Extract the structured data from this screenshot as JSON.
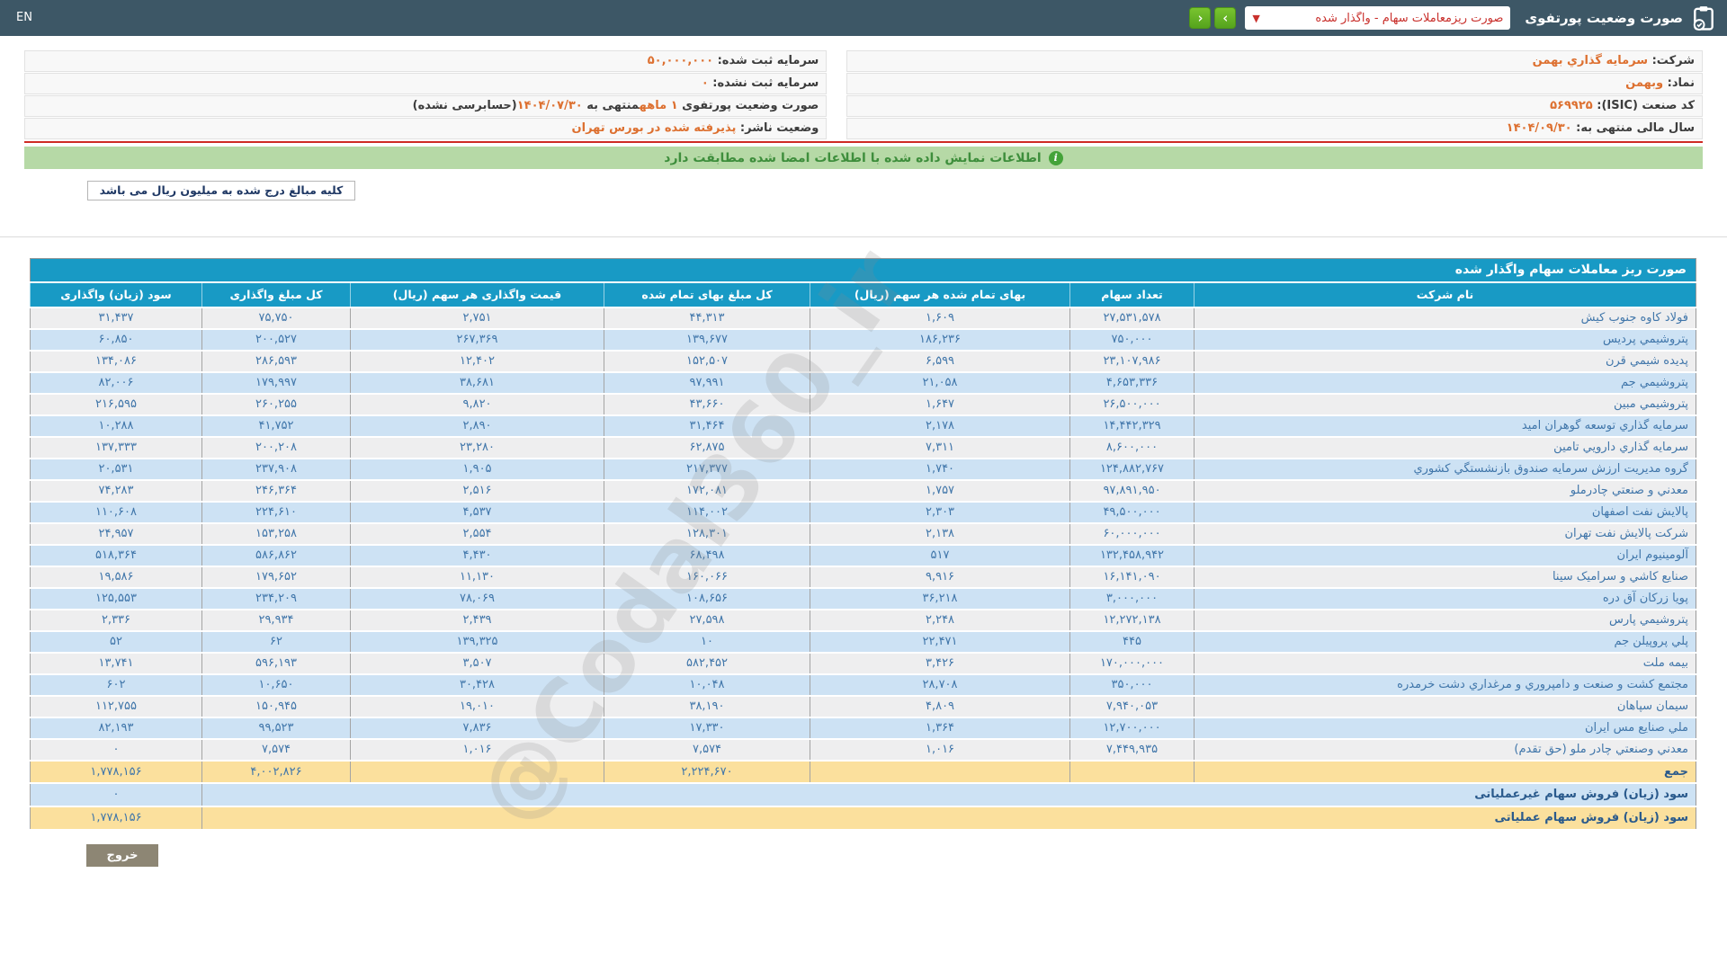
{
  "topbar": {
    "en_label": "EN",
    "page_title": "صورت وضعیت پورتفوی",
    "dropdown_value": "صورت ریزمعاملات سهام - واگذار شده",
    "dropdown_chevron": "▼",
    "next_icon": "›",
    "prev_icon": "‹"
  },
  "company_info": {
    "rows": [
      {
        "right": [
          {
            "t": "شرکت: ",
            "c": "label"
          },
          {
            "t": "سرمایه گذاري بهمن",
            "c": "value"
          }
        ],
        "left": [
          {
            "t": "سرمایه ثبت شده: ",
            "c": "label"
          },
          {
            "t": "۵۰,۰۰۰,۰۰۰",
            "c": "value"
          }
        ]
      },
      {
        "right": [
          {
            "t": "نماد: ",
            "c": "label"
          },
          {
            "t": "وبهمن",
            "c": "value"
          }
        ],
        "left": [
          {
            "t": "سرمایه ثبت نشده: ",
            "c": "label"
          },
          {
            "t": "۰",
            "c": "value"
          }
        ]
      },
      {
        "right": [
          {
            "t": "کد صنعت (ISIC): ",
            "c": "label"
          },
          {
            "t": "۵۶۹۹۲۵",
            "c": "value"
          }
        ],
        "left": [
          {
            "t": "صورت وضعیت پورتفوی ",
            "c": "label"
          },
          {
            "t": "۱ ماهه",
            "c": "value"
          },
          {
            "t": "منتهی به ",
            "c": "label"
          },
          {
            "t": "۱۴۰۴/۰۷/۳۰",
            "c": "value"
          },
          {
            "t": "(حسابرسی نشده)",
            "c": "label"
          }
        ]
      },
      {
        "right": [
          {
            "t": "سال مالی منتهی به: ",
            "c": "label"
          },
          {
            "t": "۱۴۰۴/۰۹/۳۰",
            "c": "value"
          }
        ],
        "left": [
          {
            "t": "وضعیت ناشر: ",
            "c": "label"
          },
          {
            "t": "پذیرفته شده در بورس تهران",
            "c": "value"
          }
        ]
      }
    ]
  },
  "signature_bar": {
    "text": "اطلاعات نمایش داده شده با اطلاعات امضا شده مطابقت دارد",
    "icon": "i"
  },
  "unit_note": {
    "text": "کلیه مبالغ درج شده به میلیون ریال می باشد"
  },
  "table": {
    "title": "صورت ریز معاملات سهام واگذار شده",
    "columns": [
      "نام شرکت",
      "تعداد سهام",
      "بهای تمام شده هر سهم (ریال)",
      "کل مبلغ بهای تمام شده",
      "قیمت واگذاری هر سهم (ریال)",
      "کل مبلغ واگذاری",
      "سود (زیان) واگذاری"
    ],
    "rows": [
      [
        "فولاد کاوه جنوب کیش",
        "۲۷,۵۳۱,۵۷۸",
        "۱,۶۰۹",
        "۴۴,۳۱۳",
        "۲,۷۵۱",
        "۷۵,۷۵۰",
        "۳۱,۴۳۷"
      ],
      [
        "پتروشیمي پردیس",
        "۷۵۰,۰۰۰",
        "۱۸۶,۲۳۶",
        "۱۳۹,۶۷۷",
        "۲۶۷,۳۶۹",
        "۲۰۰,۵۲۷",
        "۶۰,۸۵۰"
      ],
      [
        "پدیده شیمي قرن",
        "۲۳,۱۰۷,۹۸۶",
        "۶,۵۹۹",
        "۱۵۲,۵۰۷",
        "۱۲,۴۰۲",
        "۲۸۶,۵۹۳",
        "۱۳۴,۰۸۶"
      ],
      [
        "پتروشیمي جم",
        "۴,۶۵۳,۳۳۶",
        "۲۱,۰۵۸",
        "۹۷,۹۹۱",
        "۳۸,۶۸۱",
        "۱۷۹,۹۹۷",
        "۸۲,۰۰۶"
      ],
      [
        "پتروشیمي مبین",
        "۲۶,۵۰۰,۰۰۰",
        "۱,۶۴۷",
        "۴۳,۶۶۰",
        "۹,۸۲۰",
        "۲۶۰,۲۵۵",
        "۲۱۶,۵۹۵"
      ],
      [
        "سرمایه گذاري توسعه گوهران امید",
        "۱۴,۴۴۲,۳۲۹",
        "۲,۱۷۸",
        "۳۱,۴۶۴",
        "۲,۸۹۰",
        "۴۱,۷۵۲",
        "۱۰,۲۸۸"
      ],
      [
        "سرمایه گذاري دارویي تامین",
        "۸,۶۰۰,۰۰۰",
        "۷,۳۱۱",
        "۶۲,۸۷۵",
        "۲۳,۲۸۰",
        "۲۰۰,۲۰۸",
        "۱۳۷,۳۳۳"
      ],
      [
        "گروه مدیریت ارزش سرمایه صندوق بازنشستگي کشوري",
        "۱۲۴,۸۸۲,۷۶۷",
        "۱,۷۴۰",
        "۲۱۷,۳۷۷",
        "۱,۹۰۵",
        "۲۳۷,۹۰۸",
        "۲۰,۵۳۱"
      ],
      [
        "معدني و صنعتي چادرملو",
        "۹۷,۸۹۱,۹۵۰",
        "۱,۷۵۷",
        "۱۷۲,۰۸۱",
        "۲,۵۱۶",
        "۲۴۶,۳۶۴",
        "۷۴,۲۸۳"
      ],
      [
        "پالایش نفت اصفهان",
        "۴۹,۵۰۰,۰۰۰",
        "۲,۳۰۳",
        "۱۱۴,۰۰۲",
        "۴,۵۳۷",
        "۲۲۴,۶۱۰",
        "۱۱۰,۶۰۸"
      ],
      [
        "شرکت پالایش نفت تهران",
        "۶۰,۰۰۰,۰۰۰",
        "۲,۱۳۸",
        "۱۲۸,۳۰۱",
        "۲,۵۵۴",
        "۱۵۳,۲۵۸",
        "۲۴,۹۵۷"
      ],
      [
        "آلومینیوم ایران",
        "۱۳۲,۴۵۸,۹۴۲",
        "۵۱۷",
        "۶۸,۴۹۸",
        "۴,۴۳۰",
        "۵۸۶,۸۶۲",
        "۵۱۸,۳۶۴"
      ],
      [
        "صنایع کاشي و سرامیک سینا",
        "۱۶,۱۴۱,۰۹۰",
        "۹,۹۱۶",
        "۱۶۰,۰۶۶",
        "۱۱,۱۳۰",
        "۱۷۹,۶۵۲",
        "۱۹,۵۸۶"
      ],
      [
        "پویا زرکان آق دره",
        "۳,۰۰۰,۰۰۰",
        "۳۶,۲۱۸",
        "۱۰۸,۶۵۶",
        "۷۸,۰۶۹",
        "۲۳۴,۲۰۹",
        "۱۲۵,۵۵۳"
      ],
      [
        "پتروشیمي پارس",
        "۱۲,۲۷۲,۱۳۸",
        "۲,۲۴۸",
        "۲۷,۵۹۸",
        "۲,۴۳۹",
        "۲۹,۹۳۴",
        "۲,۳۳۶"
      ],
      [
        "پلي پروپیلن جم",
        "۴۴۵",
        "۲۲,۴۷۱",
        "۱۰",
        "۱۳۹,۳۲۵",
        "۶۲",
        "۵۲"
      ],
      [
        "بیمه ملت",
        "۱۷۰,۰۰۰,۰۰۰",
        "۳,۴۲۶",
        "۵۸۲,۴۵۲",
        "۳,۵۰۷",
        "۵۹۶,۱۹۳",
        "۱۳,۷۴۱"
      ],
      [
        "مجتمع کشت و صنعت و دامپروري و مرغداري دشت خرمدره",
        "۳۵۰,۰۰۰",
        "۲۸,۷۰۸",
        "۱۰,۰۴۸",
        "۳۰,۴۲۸",
        "۱۰,۶۵۰",
        "۶۰۲"
      ],
      [
        "سیمان سپاهان",
        "۷,۹۴۰,۰۵۳",
        "۴,۸۰۹",
        "۳۸,۱۹۰",
        "۱۹,۰۱۰",
        "۱۵۰,۹۴۵",
        "۱۱۲,۷۵۵"
      ],
      [
        "ملي صنایع مس ایران",
        "۱۲,۷۰۰,۰۰۰",
        "۱,۳۶۴",
        "۱۷,۳۳۰",
        "۷,۸۳۶",
        "۹۹,۵۲۳",
        "۸۲,۱۹۳"
      ],
      [
        "معدني وصنعتي چادر ملو (حق تقدم)",
        "۷,۴۴۹,۹۳۵",
        "۱,۰۱۶",
        "۷,۵۷۴",
        "۱,۰۱۶",
        "۷,۵۷۴",
        "۰"
      ]
    ],
    "sum_row": {
      "label": "جمع",
      "total_cost": "۲,۲۲۴,۶۷۰",
      "total_transfer": "۴,۰۰۲,۸۲۶",
      "profit": "۱,۷۷۸,۱۵۶"
    },
    "footer_rows": [
      {
        "label": "سود (زیان) فروش سهام غیرعملیاتی",
        "value": "۰",
        "style": "foot-blue"
      },
      {
        "label": "سود (زیان) فروش سهام عملیاتی",
        "value": "۱,۷۷۸,۱۵۶",
        "style": "foot-yellow"
      }
    ]
  },
  "watermark": "@Codal360_ir",
  "exit_button": {
    "label": "خروج"
  },
  "colors": {
    "topbar_bg": "#3d5766",
    "accent_teal": "#189ac5",
    "row_blue": "#cde2f4",
    "row_white": "#eeeeef",
    "row_yellow": "#fbe09d",
    "value_orange": "#dd7030",
    "data_blue": "#4076aa",
    "nav_green": "#55a31d",
    "dropdown_red": "#c9302c",
    "signature_green_bg": "#b6d9a6"
  }
}
